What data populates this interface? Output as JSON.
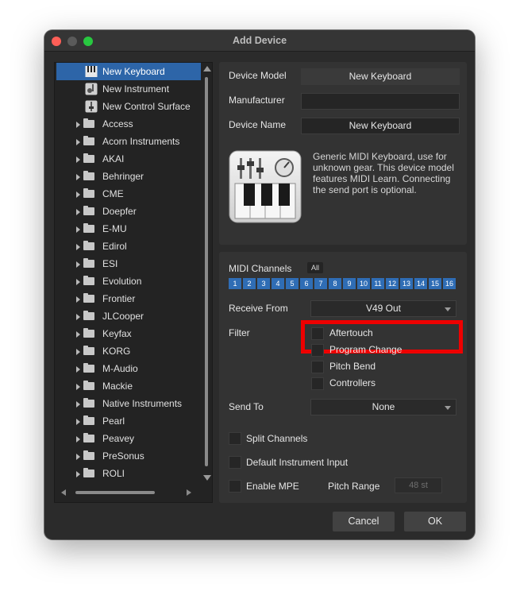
{
  "window": {
    "title": "Add Device"
  },
  "device_list": {
    "items": [
      {
        "label": "New Keyboard",
        "type": "keyboard",
        "selected": true
      },
      {
        "label": "New Instrument",
        "type": "instrument"
      },
      {
        "label": "New Control Surface",
        "type": "control-surface"
      },
      {
        "label": "Access",
        "type": "folder"
      },
      {
        "label": "Acorn Instruments",
        "type": "folder"
      },
      {
        "label": "AKAI",
        "type": "folder"
      },
      {
        "label": "Behringer",
        "type": "folder"
      },
      {
        "label": "CME",
        "type": "folder"
      },
      {
        "label": "Doepfer",
        "type": "folder"
      },
      {
        "label": "E-MU",
        "type": "folder"
      },
      {
        "label": "Edirol",
        "type": "folder"
      },
      {
        "label": "ESI",
        "type": "folder"
      },
      {
        "label": "Evolution",
        "type": "folder"
      },
      {
        "label": "Frontier",
        "type": "folder"
      },
      {
        "label": "JLCooper",
        "type": "folder"
      },
      {
        "label": "Keyfax",
        "type": "folder"
      },
      {
        "label": "KORG",
        "type": "folder"
      },
      {
        "label": "M-Audio",
        "type": "folder"
      },
      {
        "label": "Mackie",
        "type": "folder"
      },
      {
        "label": "Native Instruments",
        "type": "folder"
      },
      {
        "label": "Pearl",
        "type": "folder"
      },
      {
        "label": "Peavey",
        "type": "folder"
      },
      {
        "label": "PreSonus",
        "type": "folder"
      },
      {
        "label": "ROLI",
        "type": "folder"
      }
    ]
  },
  "details": {
    "device_model_label": "Device Model",
    "device_model_value": "New Keyboard",
    "manufacturer_label": "Manufacturer",
    "manufacturer_value": "",
    "device_name_label": "Device Name",
    "device_name_value": "New Keyboard",
    "description": "Generic MIDI Keyboard, use for unknown gear. This device model features MIDI Learn. Connecting the send port is optional."
  },
  "midi": {
    "channels_label": "MIDI Channels",
    "all_label": "All",
    "channels": [
      "1",
      "2",
      "3",
      "4",
      "5",
      "6",
      "7",
      "8",
      "9",
      "10",
      "11",
      "12",
      "13",
      "14",
      "15",
      "16"
    ],
    "receive_from_label": "Receive From",
    "receive_from_value": "V49 Out",
    "filter_label": "Filter",
    "filters": [
      "Aftertouch",
      "Program Change",
      "Pitch Bend",
      "Controllers"
    ],
    "send_to_label": "Send To",
    "send_to_value": "None",
    "split_channels_label": "Split Channels",
    "default_instrument_label": "Default Instrument Input",
    "enable_mpe_label": "Enable MPE",
    "pitch_range_label": "Pitch Range",
    "pitch_range_value": "48 st"
  },
  "footer": {
    "cancel_label": "Cancel",
    "ok_label": "OK"
  },
  "colors": {
    "selection": "#2d65a8",
    "channel": "#2f6db5",
    "highlight": "#ee0000"
  }
}
